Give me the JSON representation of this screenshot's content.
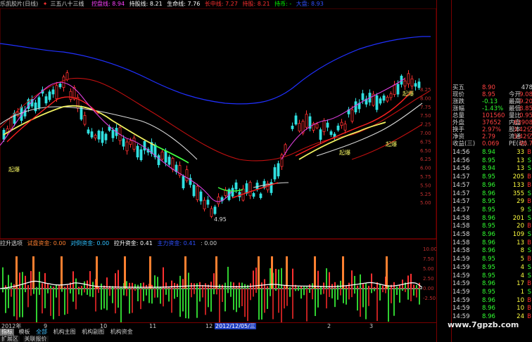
{
  "title_bar": {
    "stock": "乐凯胶片(日线)",
    "formula": "三五八十三线",
    "line1_label": "控盘线: 8.94",
    "line1_color": "#ff40ff",
    "line2_label": "持股线: 8.21",
    "line2_color": "#ffffff",
    "line3_label": "生命线: 7.76",
    "line3_color": "#ffffff",
    "line4_label": "长中线: 7.27",
    "line4_color": "#ff3030",
    "line5_label": "持股: 8.21",
    "line5_color": "#ff3030",
    "line6_label": "持币: -",
    "line6_color": "#00ff00",
    "line7_label": "大盘: 8.93",
    "line7_color": "#2040ff"
  },
  "main_chart": {
    "y_labels": [
      "8.25",
      "8.00",
      "7.75",
      "7.50",
      "7.25",
      "7.00",
      "6.75",
      "6.50",
      "6.25",
      "6.00",
      "5.75",
      "5.50",
      "5.25",
      "5.00"
    ],
    "annotations": {
      "low_price": "4.95",
      "signal1": "起爆",
      "signal2": "起爆",
      "signal3": "起爆",
      "signal4": "起爆"
    }
  },
  "sub_chart": {
    "title": "拉升选项",
    "label1": "试盘资金: 0.00",
    "label1_color": "#ff8030",
    "label2": "对倒资金: 0.00",
    "label2_color": "#30a0ff",
    "label3": "拉升资金: 0.41",
    "label3_color": "#ffffff",
    "label4": "主力资金: 0.41",
    "label4_color": "#3030ff",
    "label5": ": 0.00",
    "label5_color": "#ccc",
    "y_labels": [
      "10.00",
      "7.50",
      "5.00",
      "2.50",
      "0.00",
      "-2.50"
    ]
  },
  "date_axis": [
    "2012年",
    "9",
    "10",
    "11",
    "12",
    "2012/12/05/三",
    "2",
    "3"
  ],
  "tabs": [
    "指标",
    "模板",
    "全部",
    "机构主图",
    "机构副图",
    "机构资金"
  ],
  "ext_tabs": [
    "扩展区",
    "关联报价"
  ],
  "quote_panel": {
    "rows": [
      {
        "l": "买五",
        "v": "8.90",
        "r": "478"
      },
      {
        "l": "现价",
        "v": "8.95",
        "l2": "今开",
        "v2": "9.08"
      },
      {
        "l": "涨跌",
        "v": "-0.13",
        "l2": "最高",
        "v2": "9.20"
      },
      {
        "l": "涨幅",
        "v": "-1.43%",
        "l2": "最低",
        "v2": "8.85"
      },
      {
        "l": "总量",
        "v": "101560",
        "l2": "量比",
        "v2": "0.95"
      },
      {
        "l": "外盘",
        "v": "37652",
        "l2": "内盘",
        "v2": "63908"
      },
      {
        "l": "换手",
        "v": "2.97%",
        "l2": "股本",
        "v2": "3.42亿"
      },
      {
        "l": "净资",
        "v": "2.79",
        "l2": "流通",
        "v2": "3.42亿"
      },
      {
        "l": "收益(三)",
        "v": "0.069",
        "l2": "PE(动)",
        "v2": "96.7"
      }
    ],
    "trades": [
      [
        "14:56",
        "8.94",
        "33",
        "B"
      ],
      [
        "14:56",
        "8.95",
        "13",
        "S"
      ],
      [
        "14:56",
        "8.94",
        "13",
        "S"
      ],
      [
        "14:57",
        "8.95",
        "205",
        "B"
      ],
      [
        "14:57",
        "8.96",
        "133",
        "B"
      ],
      [
        "14:57",
        "8.96",
        "355",
        "S"
      ],
      [
        "14:57",
        "8.95",
        "29",
        "B"
      ],
      [
        "14:57",
        "8.95",
        "9",
        "S"
      ],
      [
        "14:58",
        "8.96",
        "201",
        "S"
      ],
      [
        "14:58",
        "8.95",
        "20",
        "B"
      ],
      [
        "14:58",
        "8.96",
        "109",
        "S"
      ],
      [
        "14:58",
        "8.96",
        "13",
        "B"
      ],
      [
        "14:58",
        "8.96",
        "8",
        "S"
      ],
      [
        "14:59",
        "8.95",
        "5",
        "B"
      ],
      [
        "14:59",
        "8.95",
        "4",
        "S"
      ],
      [
        "14:59",
        "8.95",
        "4",
        "S"
      ],
      [
        "14:59",
        "8.96",
        "17",
        "B"
      ],
      [
        "14:59",
        "8.95",
        "1",
        "S"
      ],
      [
        "14:59",
        "8.96",
        "10",
        "B"
      ],
      [
        "14:59",
        "8.96",
        "10",
        "B"
      ],
      [
        "14:59",
        "8.96",
        "24",
        "B"
      ]
    ]
  },
  "watermark": "www.7gpzb.com"
}
